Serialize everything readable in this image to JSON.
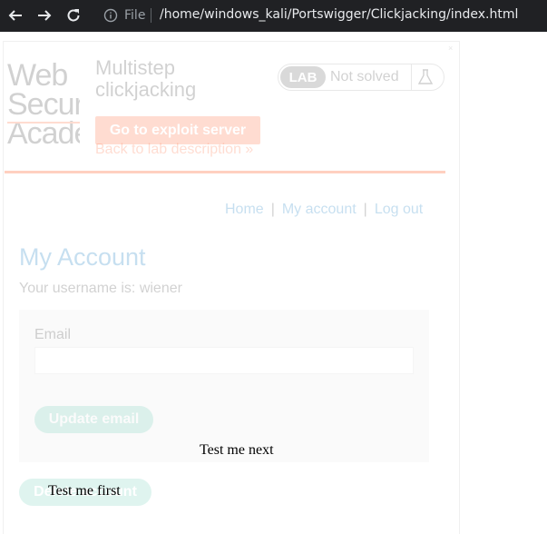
{
  "browser": {
    "file_label": "File",
    "url": "/home/windows_kali/Portswigger/Clickjacking/index.html",
    "icons": [
      "back-arrow-icon",
      "forward-arrow-icon",
      "reload-icon",
      "info-icon"
    ]
  },
  "frame": {
    "close_glyph": "×",
    "logo_text": "Web Security Academy",
    "lab": {
      "title": "Multistep clickjacking",
      "badge_tag": "LAB",
      "status": "Not solved",
      "exploit_button": "Go to exploit server",
      "back_link": "Back to lab description »"
    },
    "nav": {
      "home": "Home",
      "divider1": "|",
      "my_account": "My account",
      "divider2": "|",
      "logout": "Log out"
    },
    "account": {
      "title": "My Account",
      "username_text": "Your username is: wiener",
      "email_label": "Email",
      "email_value": "",
      "update_button": "Update email",
      "delete_button": "Delete account"
    }
  },
  "decoys": {
    "next": "Test me next",
    "first": "Test me first"
  },
  "colors": {
    "chrome_bg": "#202124",
    "brand_orange": "#ff6633",
    "link_blue": "#0071bc",
    "button_green": "#70d0b8"
  }
}
